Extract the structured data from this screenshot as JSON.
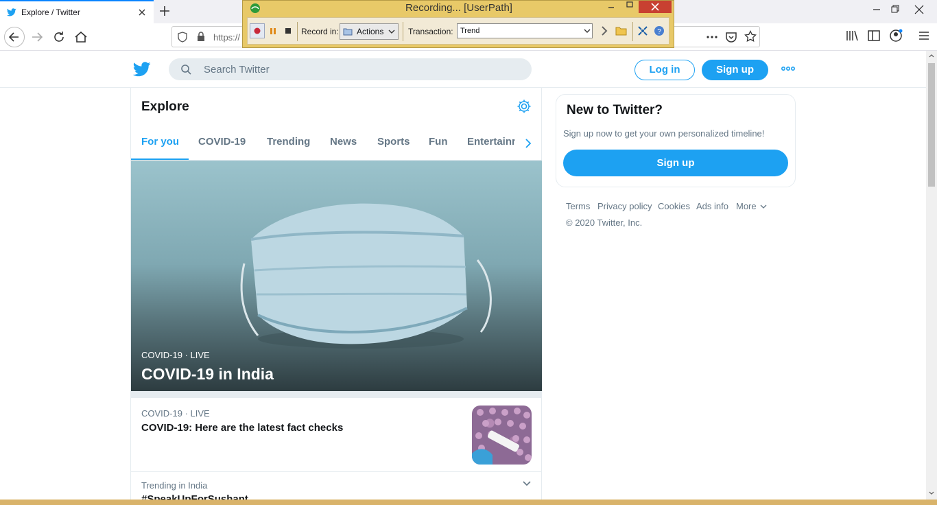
{
  "browser": {
    "tab_title": "Explore / Twitter",
    "url": "https://",
    "colors": {
      "tab_accent": "#0a84ff"
    }
  },
  "recorder": {
    "title": "Recording... [UserPath]",
    "record_in_label": "Record in:",
    "record_in_value": "Actions",
    "transaction_label": "Transaction:",
    "transaction_value": "Trend"
  },
  "twitter": {
    "search_placeholder": "Search Twitter",
    "login_label": "Log in",
    "signup_label": "Sign up",
    "colors": {
      "brand": "#1da1f2",
      "muted": "#657786"
    }
  },
  "explore": {
    "title": "Explore",
    "tabs": [
      {
        "label": "For you"
      },
      {
        "label": "COVID-19"
      },
      {
        "label": "Trending"
      },
      {
        "label": "News"
      },
      {
        "label": "Sports"
      },
      {
        "label": "Fun"
      },
      {
        "label": "Entertainment"
      }
    ],
    "hero": {
      "meta": "COVID-19 · LIVE",
      "title": "COVID-19 in India"
    },
    "items": [
      {
        "meta": "COVID-19 · LIVE",
        "title": "COVID-19: Here are the latest fact checks"
      },
      {
        "meta": "Trending in India",
        "title": "#SpeakUpForSushant"
      }
    ]
  },
  "sidebar": {
    "title": "New to Twitter?",
    "text": "Sign up now to get your own personalized timeline!",
    "signup_label": "Sign up",
    "footer_links": [
      {
        "label": "Terms"
      },
      {
        "label": "Privacy policy"
      },
      {
        "label": "Cookies"
      },
      {
        "label": "Ads info"
      },
      {
        "label": "More"
      }
    ],
    "copyright": "© 2020 Twitter, Inc."
  }
}
